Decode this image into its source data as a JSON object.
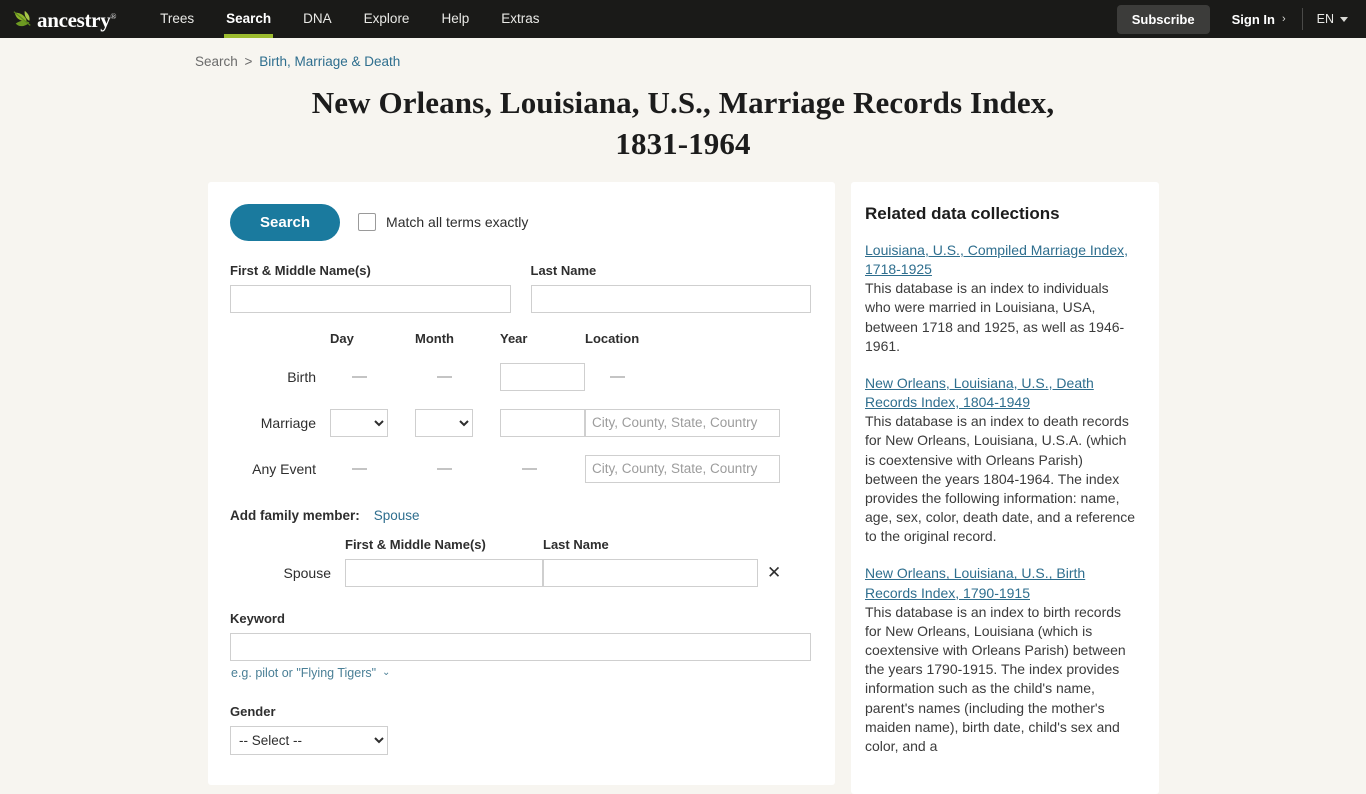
{
  "header": {
    "logo_text": "ancestry",
    "logo_tm": "®",
    "nav": [
      {
        "label": "Trees",
        "active": false
      },
      {
        "label": "Search",
        "active": true
      },
      {
        "label": "DNA",
        "active": false
      },
      {
        "label": "Explore",
        "active": false
      },
      {
        "label": "Help",
        "active": false
      },
      {
        "label": "Extras",
        "active": false
      }
    ],
    "subscribe_label": "Subscribe",
    "signin_label": "Sign In",
    "signin_chevron": "›",
    "language_label": "EN",
    "bar_color": "#1a1a18",
    "active_underline_color": "#9cbb2e"
  },
  "breadcrumb": {
    "root": "Search",
    "separator": ">",
    "current": "Birth, Marriage & Death"
  },
  "page_title": "New Orleans, Louisiana, U.S., Marriage Records Index, 1831-1964",
  "search_form": {
    "search_button": "Search",
    "match_exactly_label": "Match all terms exactly",
    "first_name_label": "First & Middle Name(s)",
    "last_name_label": "Last Name",
    "first_name_value": "",
    "last_name_value": "",
    "columns": {
      "day": "Day",
      "month": "Month",
      "year": "Year",
      "location": "Location"
    },
    "rows": [
      {
        "label": "Birth",
        "day": "—",
        "month": "—",
        "year_value": "",
        "location": "—"
      },
      {
        "label": "Marriage",
        "day_value": "",
        "month_value": "",
        "year_value": "",
        "location_placeholder": "City, County, State, Country"
      },
      {
        "label": "Any Event",
        "day": "—",
        "month": "—",
        "year": "—",
        "location_placeholder": "City, County, State, Country"
      }
    ],
    "family": {
      "add_label": "Add family member:",
      "add_link": "Spouse",
      "col_first": "First & Middle Name(s)",
      "col_last": "Last Name",
      "row_label": "Spouse",
      "first_value": "",
      "last_value": "",
      "remove_icon": "✕"
    },
    "keyword": {
      "label": "Keyword",
      "value": "",
      "hint": "e.g. pilot or \"Flying Tigers\"",
      "hint_chevron": "⌄"
    },
    "gender": {
      "label": "Gender",
      "selected": "-- Select --"
    },
    "accent_color": "#1a7a9e"
  },
  "sidebar": {
    "title": "Related data collections",
    "collections": [
      {
        "link": "Louisiana, U.S., Compiled Marriage Index, 1718-1925",
        "description": "This database is an index to individuals who were married in Louisiana, USA, between 1718 and 1925, as well as 1946-1961."
      },
      {
        "link": "New Orleans, Louisiana, U.S., Death Records Index, 1804-1949",
        "description": "This database is an index to death records for New Orleans, Louisiana, U.S.A. (which is coextensive with Orleans Parish) between the years 1804-1964. The index provides the following information: name, age, sex, color, death date, and a reference to the original record."
      },
      {
        "link": "New Orleans, Louisiana, U.S., Birth Records Index, 1790-1915",
        "description": "This database is an index to birth records for New Orleans, Louisiana (which is coextensive with Orleans Parish) between the years 1790-1915. The index provides information such as the child's name, parent's names (including the mother's maiden name), birth date, child's sex and color, and a"
      }
    ],
    "link_color": "#2e6e8e"
  }
}
